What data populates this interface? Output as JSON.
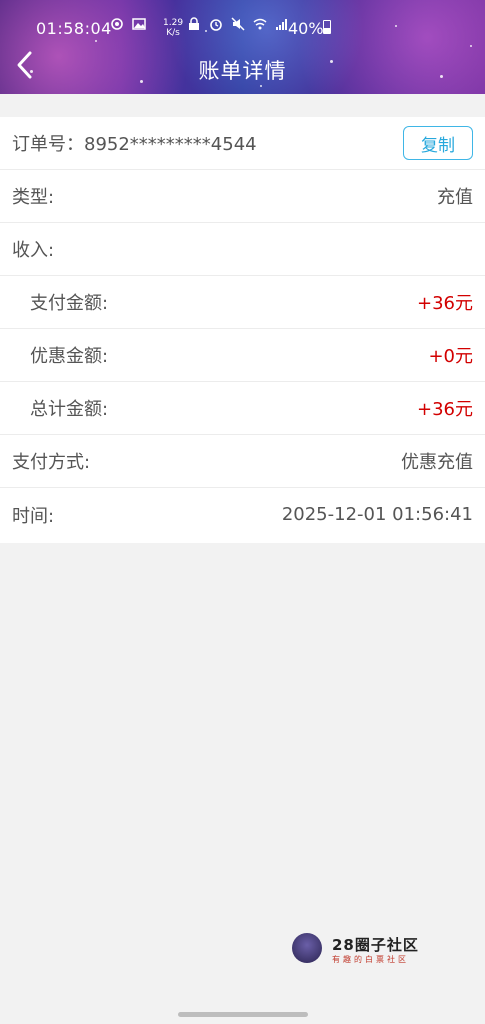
{
  "status_bar": {
    "time": "01:58:04",
    "speed_value": "1.29",
    "speed_unit": "K/s",
    "battery": "40%"
  },
  "header": {
    "title": "账单详情"
  },
  "order": {
    "label": "订单号：",
    "number": "8952*********4544",
    "copy_label": "复制"
  },
  "rows": {
    "type": {
      "label": "类型:",
      "value": "充值"
    },
    "income": {
      "label": "收入:"
    },
    "paid": {
      "label": "支付金额:",
      "value": "+36元"
    },
    "discount": {
      "label": "优惠金额:",
      "value": "+0元"
    },
    "total": {
      "label": "总计金额:",
      "value": "+36元"
    },
    "method": {
      "label": "支付方式:",
      "value": "优惠充值"
    },
    "time": {
      "label": "时间:",
      "value": "2025-12-01 01:56:41"
    }
  },
  "colors": {
    "amount_red": "#d20000",
    "copy_accent": "#27a8dc"
  },
  "logo": {
    "main": "28圈子社区",
    "sub": "有趣的白票社区"
  }
}
